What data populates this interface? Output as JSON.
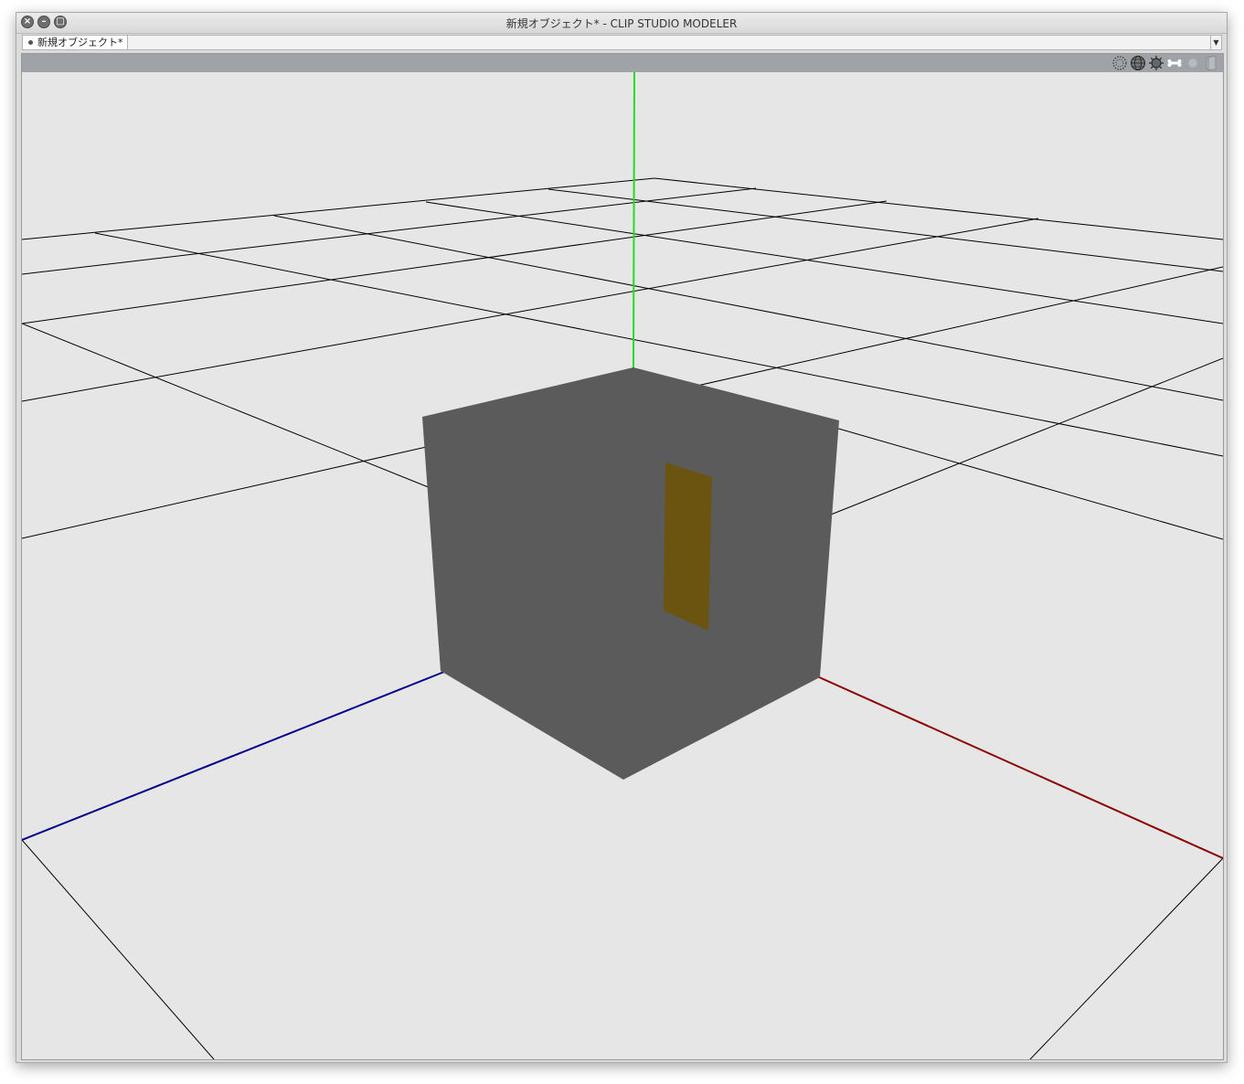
{
  "window": {
    "title": "新規オブジェクト* - CLIP STUDIO MODELER",
    "controls": [
      "close",
      "minimize",
      "maximize"
    ]
  },
  "tabs": [
    {
      "label": "新規オブジェクト*",
      "active": true
    }
  ],
  "viewport_toolbar": {
    "icons": [
      "vertex-display-icon",
      "wireframe-sphere-icon",
      "light-gear-icon",
      "bone-icon",
      "hidden-object-icon",
      "flag-icon"
    ]
  },
  "scene": {
    "background_color": "#e6e6e6",
    "cube_color": "#5b5b5b",
    "selected_face_color": "#6a5410",
    "axis_colors": {
      "y": "#22dd22",
      "x": "#8b0000",
      "z": "#00008b"
    },
    "grid_color": "#000000"
  }
}
